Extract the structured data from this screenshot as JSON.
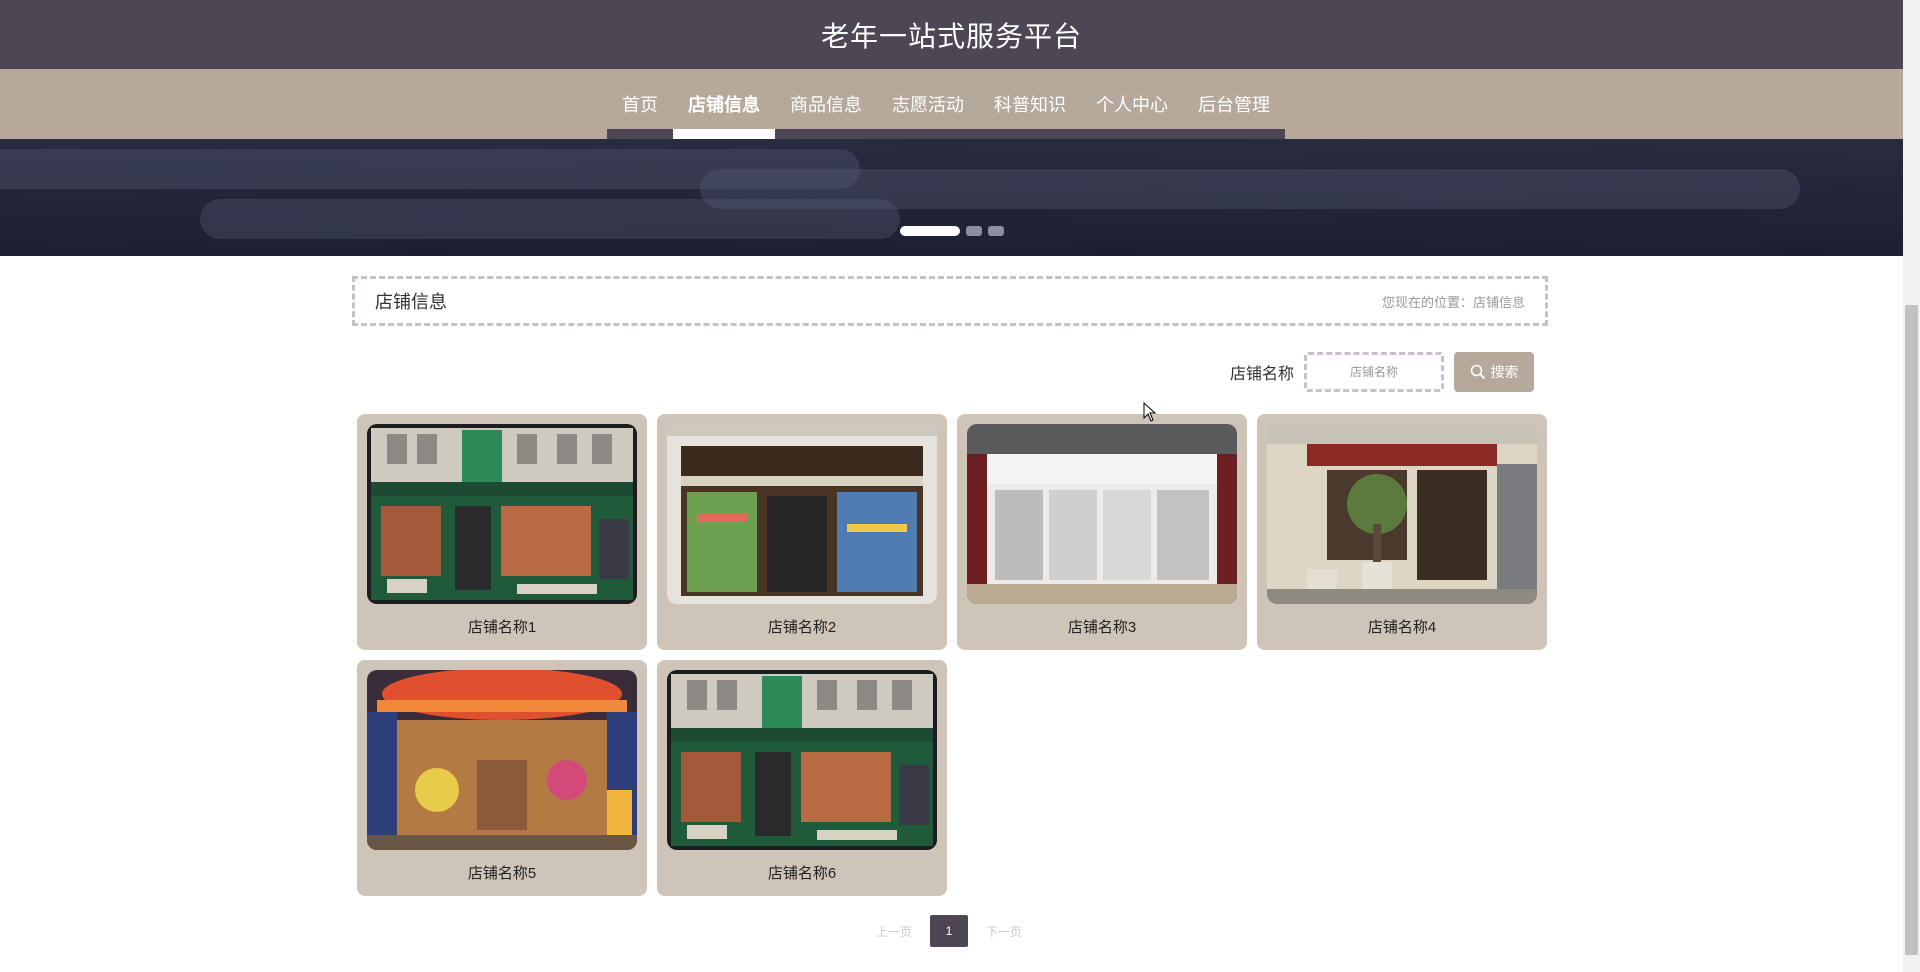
{
  "header": {
    "site_title": "老年一站式服务平台"
  },
  "nav": {
    "items": [
      {
        "label": "首页",
        "active": false
      },
      {
        "label": "店铺信息",
        "active": true
      },
      {
        "label": "商品信息",
        "active": false
      },
      {
        "label": "志愿活动",
        "active": false
      },
      {
        "label": "科普知识",
        "active": false
      },
      {
        "label": "个人中心",
        "active": false
      },
      {
        "label": "后台管理",
        "active": false
      }
    ]
  },
  "banner": {
    "slide_count": 3,
    "active_slide": 1
  },
  "breadcrumb": {
    "title": "店铺信息",
    "path": "您现在的位置：店铺信息"
  },
  "search": {
    "label": "店铺名称",
    "placeholder": "店铺名称",
    "button_label": "搜索"
  },
  "shops": [
    {
      "name": "店铺名称1",
      "image": "storefront-green-desserts"
    },
    {
      "name": "店铺名称2",
      "image": "storefront-price-wise-discount"
    },
    {
      "name": "店铺名称3",
      "image": "storefront-white-boutique"
    },
    {
      "name": "店铺名称4",
      "image": "storefront-cream-tree"
    },
    {
      "name": "店铺名称5",
      "image": "storefront-disney-store"
    },
    {
      "name": "店铺名称6",
      "image": "storefront-green-desserts"
    }
  ],
  "pagination": {
    "prev_label": "上一页",
    "current_page": "1",
    "next_label": "下一页"
  },
  "colors": {
    "header_bg": "#4e4654",
    "nav_bg": "#b6a99c",
    "card_bg": "#cfc4b8",
    "accent": "#4e4654"
  }
}
